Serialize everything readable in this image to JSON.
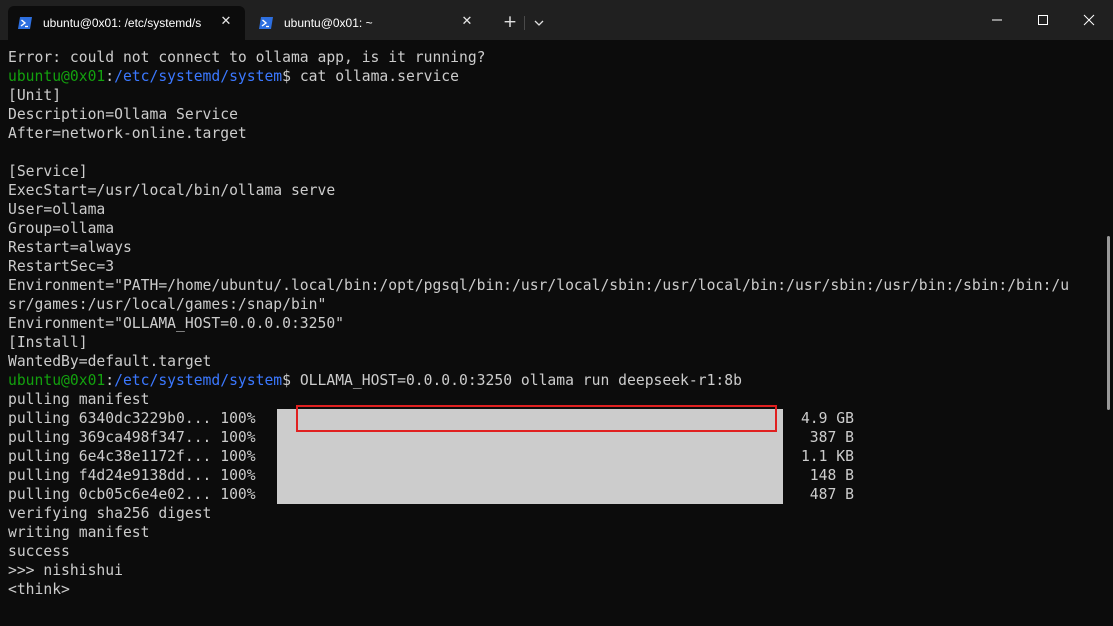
{
  "tabs": [
    {
      "title": "ubuntu@0x01: /etc/systemd/s",
      "icon": "powershell-icon",
      "active": true
    },
    {
      "title": "ubuntu@0x01: ~",
      "icon": "powershell-icon",
      "active": false
    }
  ],
  "tab_controls": {
    "close": "✕",
    "new_tab": "+"
  },
  "terminal": {
    "error_line": "Error: could not connect to ollama app, is it running?",
    "prompt_user": "ubuntu@0x01",
    "prompt_colon": ":",
    "prompt_path": "/etc/systemd/system",
    "prompt_symbol": "$",
    "command_1": " cat ollama.service",
    "file_lines": [
      "[Unit]",
      "Description=Ollama Service",
      "After=network-online.target",
      "",
      "[Service]",
      "ExecStart=/usr/local/bin/ollama serve",
      "User=ollama",
      "Group=ollama",
      "Restart=always",
      "RestartSec=3",
      "Environment=\"PATH=/home/ubuntu/.local/bin:/opt/pgsql/bin:/usr/local/sbin:/usr/local/bin:/usr/sbin:/usr/bin:/sbin:/bin:/u",
      "sr/games:/usr/local/games:/snap/bin\"",
      "Environment=\"OLLAMA_HOST=0.0.0.0:3250\"",
      "[Install]",
      "WantedBy=default.target"
    ],
    "command_2": " OLLAMA_HOST=0.0.0.0:3250 ollama run deepseek-r1:8b",
    "pulling_manifest": "pulling manifest",
    "pulls": [
      {
        "label": "pulling 6340dc3229b0... 100%",
        "size": "4.9 GB",
        "progress": 1.0
      },
      {
        "label": "pulling 369ca498f347... 100%",
        "size": "387 B",
        "progress": 1.0
      },
      {
        "label": "pulling 6e4c38e1172f... 100%",
        "size": "1.1 KB",
        "progress": 1.0
      },
      {
        "label": "pulling f4d24e9138dd... 100%",
        "size": "148 B",
        "progress": 1.0
      },
      {
        "label": "pulling 0cb05c6e4e02... 100%",
        "size": "487 B",
        "progress": 1.0
      }
    ],
    "after_lines": [
      "verifying sha256 digest",
      "writing manifest",
      "success",
      ">>> nishishui",
      "<think>"
    ]
  },
  "colors": {
    "background": "#0c0c0c",
    "titlebar": "#202020",
    "user": "#13a10e",
    "path": "#3b78ff",
    "text": "#cccccc",
    "highlight_border": "#e02020"
  }
}
